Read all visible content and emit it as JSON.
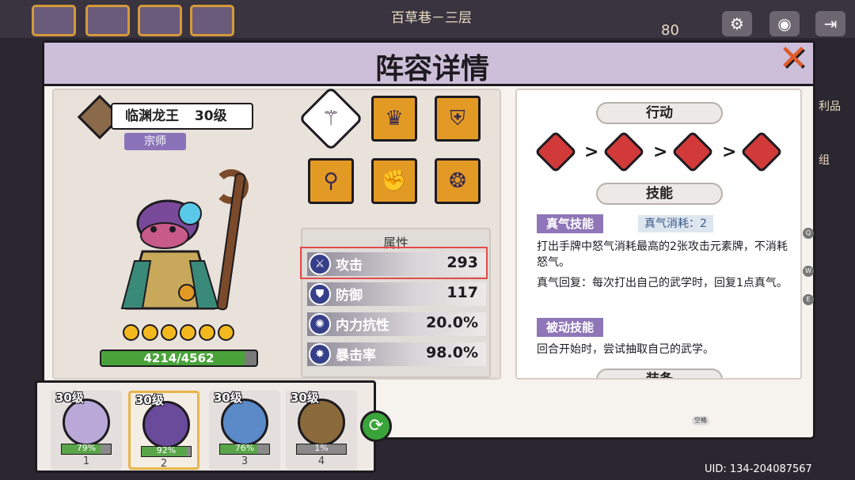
{
  "top": {
    "title": "百草巷－三层",
    "score": "80"
  },
  "panel": {
    "title": "阵容详情",
    "close_label": "✕"
  },
  "hero": {
    "name": "临渊龙王",
    "level": "30级",
    "rank": "宗师",
    "stars": 6,
    "hp_text": "4214/4562",
    "hp_fraction": 0.924
  },
  "equipment": [
    {
      "icon": "staff-icon",
      "glyph": "⚚"
    },
    {
      "icon": "helmet-icon",
      "glyph": "♛"
    },
    {
      "icon": "armor-icon",
      "glyph": "⛨"
    },
    {
      "icon": "boots-icon",
      "glyph": "⚲"
    },
    {
      "icon": "gauntlets-icon",
      "glyph": "✊"
    },
    {
      "icon": "pendant-icon",
      "glyph": "❂"
    }
  ],
  "attributes": {
    "title": "属性",
    "rows": [
      {
        "label": "攻击",
        "value": "293",
        "icon": "sword-icon",
        "glyph": "⚔"
      },
      {
        "label": "防御",
        "value": "117",
        "icon": "shield-icon",
        "glyph": "⛊"
      },
      {
        "label": "内力抗性",
        "value": "20.0%",
        "icon": "spiral-icon",
        "glyph": "✺"
      },
      {
        "label": "暴击率",
        "value": "98.0%",
        "icon": "crit-icon",
        "glyph": "✸"
      }
    ]
  },
  "actions": {
    "action_tab": "行动",
    "skill_tab": "技能",
    "equip_tab": "装备",
    "arrow": ">"
  },
  "skills": {
    "qi_tag": "真气技能",
    "qi_cost": "真气消耗：2",
    "qi_desc": "打出手牌中怒气消耗最高的2张攻击元素牌，不消耗怒气。",
    "qi_recover": "真气回复：每次打出自己的武学时，回复1点真气。",
    "passive_tag": "被动技能",
    "passive_desc": "回合开始时，尝试抽取自己的武学。"
  },
  "team": [
    {
      "level": "30级",
      "pct": "79%",
      "fraction": 0.79,
      "num": "1",
      "color": "#b9a8d8"
    },
    {
      "level": "30级",
      "pct": "92%",
      "fraction": 0.92,
      "num": "2",
      "color": "#6a4a9a"
    },
    {
      "level": "30级",
      "pct": "76%",
      "fraction": 0.76,
      "num": "3",
      "color": "#5a8ac8"
    },
    {
      "level": "30级",
      "pct": "1%",
      "fraction": 0.01,
      "num": "4",
      "color": "#8a6a3a"
    }
  ],
  "side": {
    "label_1": "利品",
    "label_2": "组",
    "keys": [
      "Q",
      "W",
      "E"
    ]
  },
  "hint": "空格",
  "uid": "UID: 134-204087567",
  "colors": {
    "accent_orange": "#e39a24",
    "rank_purple": "#8a73b8",
    "hp_green": "#4aa33a",
    "action_red": "#d23a3a",
    "highlight_red": "#e34a4a"
  }
}
